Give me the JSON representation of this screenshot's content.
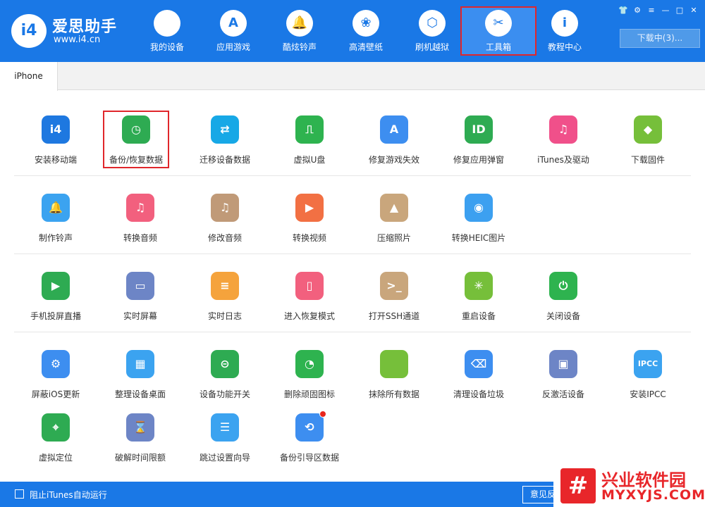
{
  "app": {
    "name": "爱思助手",
    "url": "www.i4.cn",
    "logo_glyph": "i4"
  },
  "window_controls": [
    "👕",
    "⚙",
    "≡",
    "—",
    "□",
    "✕"
  ],
  "nav": [
    {
      "label": "我的设备",
      "icon": "apple-icon",
      "glyph": ""
    },
    {
      "label": "应用游戏",
      "icon": "app-store-icon",
      "glyph": "A"
    },
    {
      "label": "酷炫铃声",
      "icon": "bell-icon",
      "glyph": "🔔"
    },
    {
      "label": "高清壁纸",
      "icon": "flower-icon",
      "glyph": "❀"
    },
    {
      "label": "刷机越狱",
      "icon": "box-icon",
      "glyph": "⬡"
    },
    {
      "label": "工具箱",
      "icon": "tools-icon",
      "glyph": "✂",
      "active": true
    },
    {
      "label": "教程中心",
      "icon": "info-icon",
      "glyph": "i"
    }
  ],
  "download_button": "下载中(3)...",
  "tabs": [
    {
      "label": "iPhone"
    }
  ],
  "tools": [
    {
      "label": "安装移动端",
      "icon": "i4-app-icon",
      "glyph": "i4",
      "color": "#1e78e0"
    },
    {
      "label": "备份/恢复数据",
      "icon": "backup-clock-icon",
      "glyph": "◷",
      "color": "#2eab52",
      "highlight": true
    },
    {
      "label": "迁移设备数据",
      "icon": "migrate-icon",
      "glyph": "⇄",
      "color": "#17a8e6"
    },
    {
      "label": "虚拟U盘",
      "icon": "usb-icon",
      "glyph": "⎍",
      "color": "#2eb34f"
    },
    {
      "label": "修复游戏失效",
      "icon": "app-store-repair-icon",
      "glyph": "A",
      "color": "#3d8ef0"
    },
    {
      "label": "修复应用弹窗",
      "icon": "apple-id-icon",
      "glyph": "ID",
      "color": "#2eab52"
    },
    {
      "label": "iTunes及驱动",
      "icon": "itunes-icon",
      "glyph": "♫",
      "color": "#f0508a"
    },
    {
      "label": "下载固件",
      "icon": "cube-icon",
      "glyph": "◆",
      "color": "#76bf3a"
    },
    {
      "label": "制作铃声",
      "icon": "bell-plus-icon",
      "glyph": "🔔",
      "color": "#3ba3f0"
    },
    {
      "label": "转换音频",
      "icon": "music-icon",
      "glyph": "♫",
      "color": "#f2607e"
    },
    {
      "label": "修改音频",
      "icon": "music-edit-icon",
      "glyph": "♫",
      "color": "#c09a78"
    },
    {
      "label": "转换视频",
      "icon": "play-icon",
      "glyph": "▶",
      "color": "#f27043"
    },
    {
      "label": "压缩照片",
      "icon": "photo-icon",
      "glyph": "▲",
      "color": "#c9a67c"
    },
    {
      "label": "转换HEIC图片",
      "icon": "heic-icon",
      "glyph": "◉",
      "color": "#3ca0f0"
    },
    {
      "label": "手机投屏直播",
      "icon": "cast-icon",
      "glyph": "▶",
      "color": "#2eab52"
    },
    {
      "label": "实时屏幕",
      "icon": "monitor-icon",
      "glyph": "▭",
      "color": "#6d85c6"
    },
    {
      "label": "实时日志",
      "icon": "log-icon",
      "glyph": "≡",
      "color": "#f5a33c"
    },
    {
      "label": "进入恢复模式",
      "icon": "recovery-icon",
      "glyph": "▯",
      "color": "#f2607e"
    },
    {
      "label": "打开SSH通道",
      "icon": "ssh-icon",
      "glyph": ">_",
      "color": "#c9a67c"
    },
    {
      "label": "重启设备",
      "icon": "restart-icon",
      "glyph": "✳",
      "color": "#76bf3a"
    },
    {
      "label": "关闭设备",
      "icon": "power-icon",
      "glyph": "⏻",
      "color": "#2eb34f"
    },
    {
      "label": "屏蔽iOS更新",
      "icon": "block-update-icon",
      "glyph": "⚙",
      "color": "#3d8ef0"
    },
    {
      "label": "整理设备桌面",
      "icon": "desktop-grid-icon",
      "glyph": "▦",
      "color": "#3ba3f0"
    },
    {
      "label": "设备功能开关",
      "icon": "toggle-icon",
      "glyph": "⊝",
      "color": "#2eab52"
    },
    {
      "label": "删除顽固图标",
      "icon": "pie-icon",
      "glyph": "◔",
      "color": "#2eb34f"
    },
    {
      "label": "抹除所有数据",
      "icon": "erase-apple-icon",
      "glyph": "",
      "color": "#76bf3a"
    },
    {
      "label": "清理设备垃圾",
      "icon": "broom-icon",
      "glyph": "⌫",
      "color": "#3d8ef0"
    },
    {
      "label": "反激活设备",
      "icon": "deactivate-icon",
      "glyph": "▣",
      "color": "#6d85c6"
    },
    {
      "label": "安装IPCC",
      "icon": "ipcc-icon",
      "glyph": "IPCC",
      "color": "#3ba3f0"
    },
    {
      "label": "虚拟定位",
      "icon": "location-pin-icon",
      "glyph": "⌖",
      "color": "#2eab52"
    },
    {
      "label": "破解时间限额",
      "icon": "hourglass-icon",
      "glyph": "⌛",
      "color": "#6d85c6"
    },
    {
      "label": "跳过设置向导",
      "icon": "skip-wizard-icon",
      "glyph": "☰",
      "color": "#3ba3f0"
    },
    {
      "label": "备份引导区数据",
      "icon": "boot-backup-icon",
      "glyph": "⟲",
      "color": "#3d8ef0",
      "badge": true
    }
  ],
  "footer": {
    "checkbox_label": "阻止iTunes自动运行",
    "feedback_label": "意见反馈"
  },
  "watermark": {
    "mark": "#",
    "cn": "兴业软件园",
    "en": "MYXYJS.COM"
  }
}
